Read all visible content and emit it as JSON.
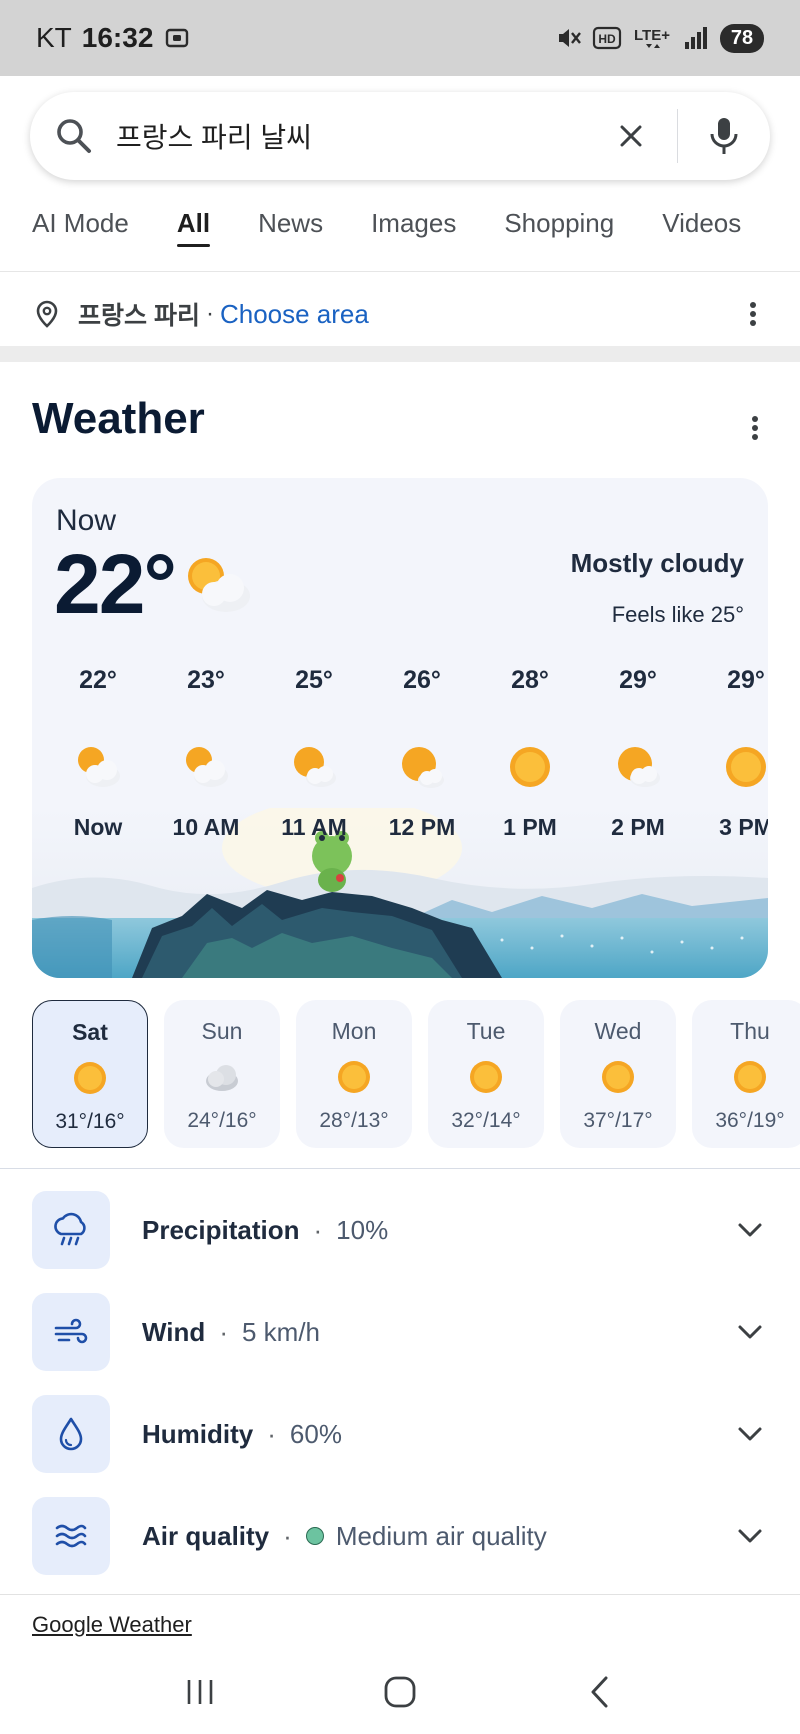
{
  "status_bar": {
    "carrier": "KT",
    "time": "16:32",
    "battery": "78"
  },
  "search": {
    "query": "프랑스 파리 날씨"
  },
  "tabs": [
    {
      "label": "AI Mode"
    },
    {
      "label": "All"
    },
    {
      "label": "News"
    },
    {
      "label": "Images"
    },
    {
      "label": "Shopping"
    },
    {
      "label": "Videos"
    }
  ],
  "location": {
    "name": "프랑스 파리",
    "separator": "·",
    "choose_area": "Choose area"
  },
  "weather": {
    "title": "Weather",
    "now_label": "Now",
    "temperature": "22°",
    "condition": "Mostly cloudy",
    "feels_like": "Feels like 25°",
    "hourly": [
      {
        "temp": "22°",
        "icon": "sun-behind-cloud-icon",
        "label": "Now"
      },
      {
        "temp": "23°",
        "icon": "sun-behind-cloud-icon",
        "label": "10 AM"
      },
      {
        "temp": "25°",
        "icon": "sun-behind-cloud-icon",
        "label": "11 AM"
      },
      {
        "temp": "26°",
        "icon": "sun-behind-cloud-icon",
        "label": "12 PM"
      },
      {
        "temp": "28°",
        "icon": "sun-icon",
        "label": "1 PM"
      },
      {
        "temp": "29°",
        "icon": "sun-behind-cloud-icon",
        "label": "2 PM"
      },
      {
        "temp": "29°",
        "icon": "sun-icon",
        "label": "3 PM"
      }
    ],
    "daily": [
      {
        "day": "Sat",
        "icon": "sun-icon",
        "temps": "31°/16°",
        "selected": true
      },
      {
        "day": "Sun",
        "icon": "cloud-icon",
        "temps": "24°/16°"
      },
      {
        "day": "Mon",
        "icon": "sun-icon",
        "temps": "28°/13°"
      },
      {
        "day": "Tue",
        "icon": "sun-icon",
        "temps": "32°/14°"
      },
      {
        "day": "Wed",
        "icon": "sun-icon",
        "temps": "37°/17°"
      },
      {
        "day": "Thu",
        "icon": "sun-icon",
        "temps": "36°/19°"
      }
    ],
    "details": [
      {
        "label": "Precipitation",
        "value": "10%",
        "icon": "rain-cloud-icon"
      },
      {
        "label": "Wind",
        "value": "5 km/h",
        "icon": "wind-icon"
      },
      {
        "label": "Humidity",
        "value": "60%",
        "icon": "water-drop-icon"
      },
      {
        "label": "Air quality",
        "value": "Medium air quality",
        "icon": "air-waves-icon"
      }
    ],
    "detail_separator": "·",
    "source": "Google Weather"
  },
  "colors": {
    "accent_link": "#1a62c2",
    "card_bg": "#f3f5fb",
    "icon_box_bg": "#e6edfb",
    "sun": "#f5a623",
    "air_quality_dot": "#6cc3a0"
  }
}
